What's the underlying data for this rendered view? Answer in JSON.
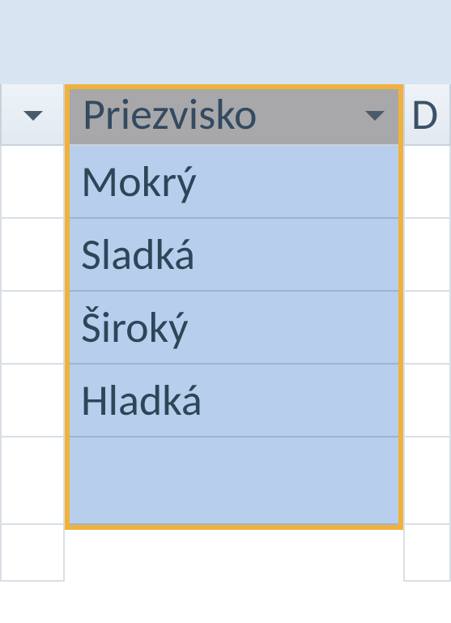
{
  "ribbon": {},
  "grid": {
    "columns": {
      "a": {
        "label": ""
      },
      "b": {
        "label": "Priezvisko",
        "selected": true
      },
      "c": {
        "label": "D"
      }
    },
    "rows": [
      {
        "b": "Mokrý"
      },
      {
        "b": "Sladká"
      },
      {
        "b": "Široký"
      },
      {
        "b": "Hladká"
      },
      {
        "b": ""
      }
    ]
  }
}
